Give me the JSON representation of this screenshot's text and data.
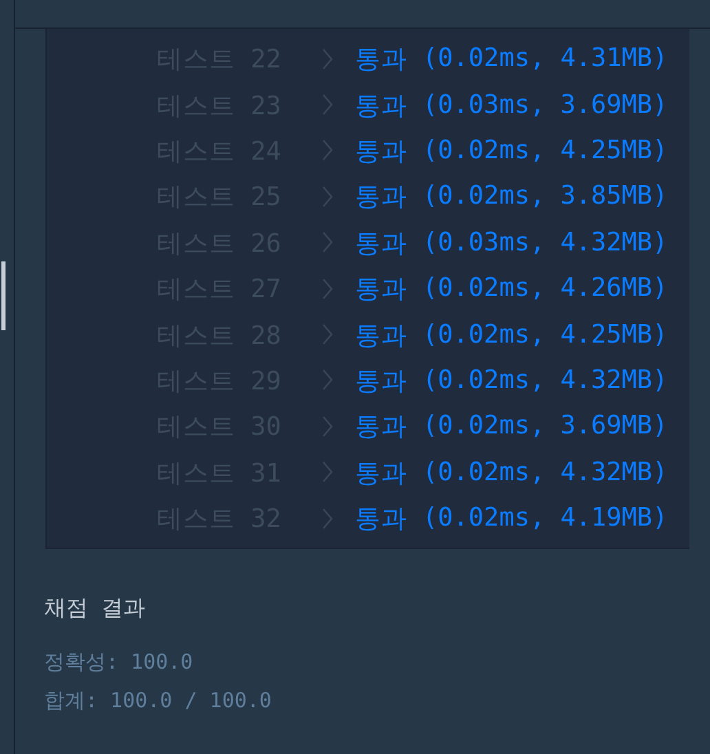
{
  "results": [
    {
      "label": "테스트 22",
      "passed": true,
      "verdict": "통과",
      "detail": "(0.02ms, 4.31MB)"
    },
    {
      "label": "테스트 23",
      "passed": true,
      "verdict": "통과",
      "detail": "(0.03ms, 3.69MB)"
    },
    {
      "label": "테스트 24",
      "passed": true,
      "verdict": "통과",
      "detail": "(0.02ms, 4.25MB)"
    },
    {
      "label": "테스트 25",
      "passed": true,
      "verdict": "통과",
      "detail": "(0.02ms, 3.85MB)"
    },
    {
      "label": "테스트 26",
      "passed": true,
      "verdict": "통과",
      "detail": "(0.03ms, 4.32MB)"
    },
    {
      "label": "테스트 27",
      "passed": true,
      "verdict": "통과",
      "detail": "(0.02ms, 4.26MB)"
    },
    {
      "label": "테스트 28",
      "passed": true,
      "verdict": "통과",
      "detail": "(0.02ms, 4.25MB)"
    },
    {
      "label": "테스트 29",
      "passed": true,
      "verdict": "통과",
      "detail": "(0.02ms, 4.32MB)"
    },
    {
      "label": "테스트 30",
      "passed": true,
      "verdict": "통과",
      "detail": "(0.02ms, 3.69MB)"
    },
    {
      "label": "테스트 31",
      "passed": true,
      "verdict": "통과",
      "detail": "(0.02ms, 4.32MB)"
    },
    {
      "label": "테스트 32",
      "passed": true,
      "verdict": "통과",
      "detail": "(0.02ms, 4.19MB)"
    }
  ],
  "summary": {
    "title": "채점 결과",
    "lines": [
      "정확성: 100.0",
      "합계: 100.0 / 100.0"
    ]
  }
}
